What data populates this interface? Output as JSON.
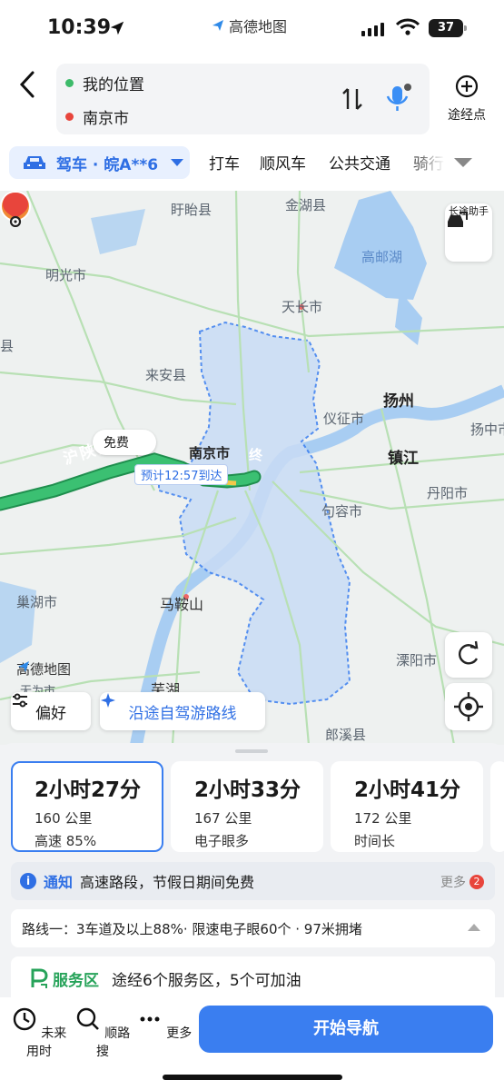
{
  "status_bar": {
    "time": "10:39",
    "brand": "高德地图",
    "battery": "37"
  },
  "route": {
    "from": "我的位置",
    "to": "南京市",
    "waypoint_label": "途经点"
  },
  "modes": {
    "car_label": "驾车 · 皖A**6",
    "tabs": [
      "打车",
      "顺风车",
      "公共交通",
      "骑行"
    ]
  },
  "map": {
    "long_trip_label": "长途助手",
    "free_tag": "免费",
    "eta": "预计12:57到达",
    "end_label": "终",
    "highway": "沪陕高速",
    "logo": "高德地图",
    "preference_label": "偏好",
    "scenic_label": "沿途自驾游路线",
    "places": {
      "xuyi": "盱眙县",
      "jinhu": "金湖县",
      "gaoyou": "高邮湖",
      "mingguang": "明光市",
      "tianchang": "天长市",
      "laian": "来安县",
      "yangzhou": "扬州",
      "yizheng": "仪征市",
      "yangzhong": "扬中市",
      "nanjing": "南京市",
      "zhenjiang": "镇江",
      "danyang": "丹阳市",
      "jurong": "句容市",
      "chaohu": "巢湖市",
      "maanshan": "马鞍山",
      "liyang": "溧阳市",
      "wuhu": "芜湖",
      "langxi": "郎溪县",
      "wuwei": "无为市",
      "xian_edge": "县"
    }
  },
  "routes": [
    {
      "duration": "2小时27分",
      "distance": "160 公里",
      "tag": "高速 85%",
      "active": true
    },
    {
      "duration": "2小时33分",
      "distance": "167 公里",
      "tag": "电子眼多",
      "active": false
    },
    {
      "duration": "2小时41分",
      "distance": "172 公里",
      "tag": "时间长",
      "active": false
    }
  ],
  "notice": {
    "title": "通知",
    "text": "高速路段，节假日期间免费",
    "more": "更多",
    "count": "2"
  },
  "route_info": "路线一：3车道及以上88%· 限速电子眼60个 · 97米拥堵",
  "service_area": {
    "label": "服务区",
    "text": "途经6个服务区，5个可加油"
  },
  "bottom_nav": {
    "future": "未来用时",
    "along": "顺路搜",
    "more": "更多",
    "start": "开始导航"
  },
  "colors": {
    "accent": "#3a7ef0",
    "route_green": "#2fb36a",
    "city_fill": "#c9dcf5",
    "end_red": "#e8453c"
  }
}
